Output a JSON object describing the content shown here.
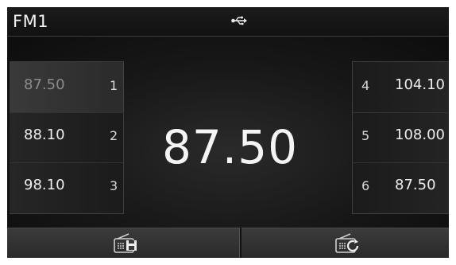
{
  "header": {
    "band": "FM1",
    "usb_icon": "usb-icon"
  },
  "main": {
    "frequency": "87.50"
  },
  "presets_left": [
    {
      "freq": "87.50",
      "num": "1",
      "selected": true
    },
    {
      "freq": "88.10",
      "num": "2",
      "selected": false
    },
    {
      "freq": "98.10",
      "num": "3",
      "selected": false
    }
  ],
  "presets_right": [
    {
      "num": "4",
      "freq": "104.10"
    },
    {
      "num": "5",
      "freq": "108.00"
    },
    {
      "num": "6",
      "freq": "87.50"
    }
  ],
  "buttons": {
    "left_icon": "radio-save-icon",
    "right_icon": "radio-scan-icon"
  }
}
